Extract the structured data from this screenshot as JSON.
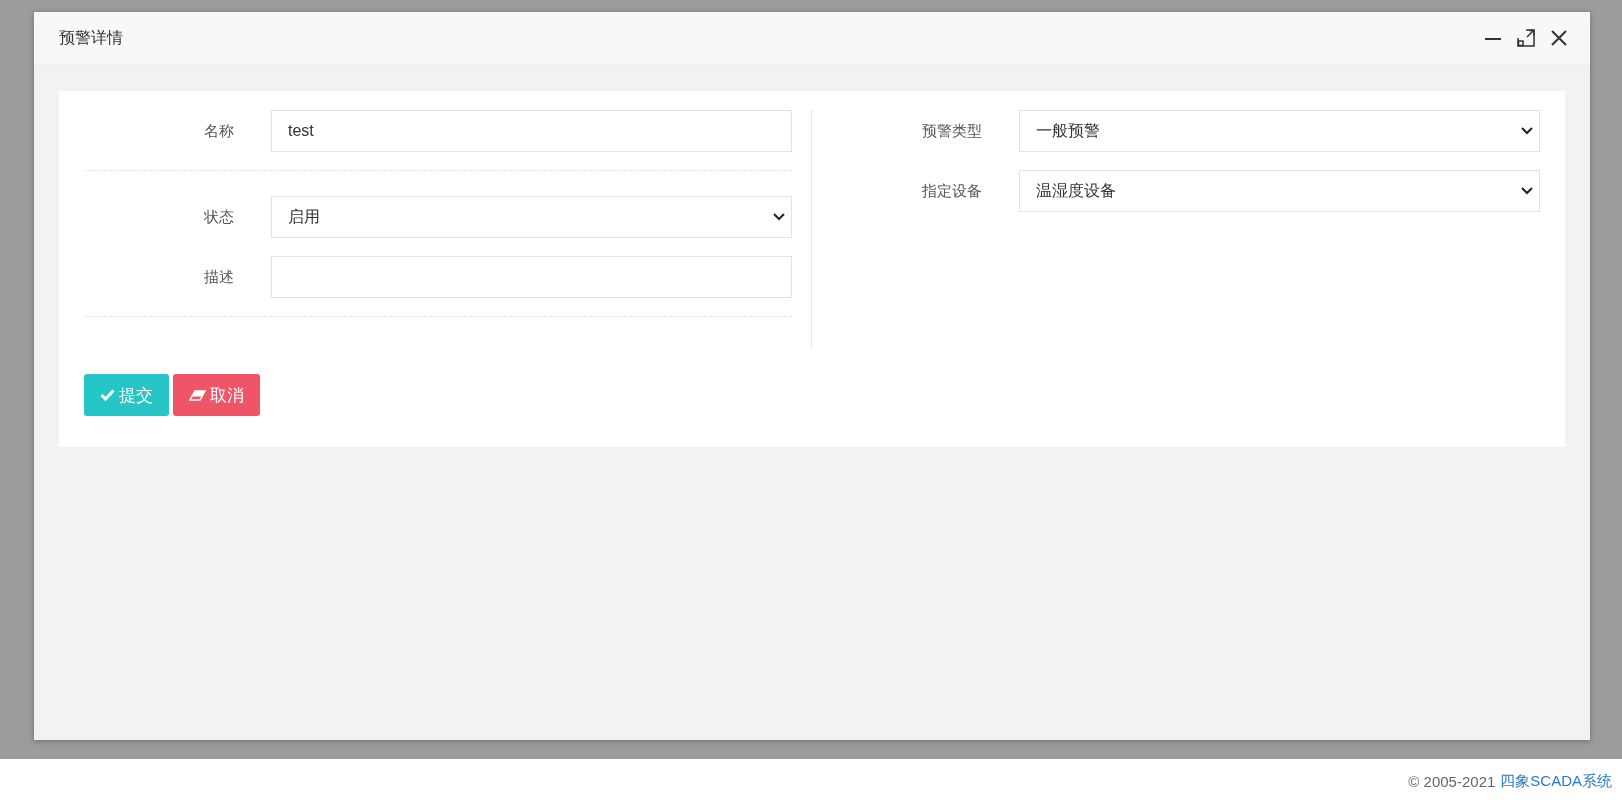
{
  "dialog": {
    "title": "预警详情",
    "controls": [
      {
        "kind": "minimize"
      },
      {
        "kind": "maximize"
      },
      {
        "kind": "close"
      }
    ]
  },
  "form": {
    "left": [
      {
        "label": "名称",
        "kind": "text",
        "value": "test",
        "divider_after": true
      },
      {
        "label": "状态",
        "kind": "select",
        "value": "启用",
        "divider_after": false
      },
      {
        "label": "描述",
        "kind": "text",
        "divider_after": true
      }
    ],
    "right": [
      {
        "label": "预警类型",
        "kind": "select",
        "value": "一般预警",
        "divider_after": false
      },
      {
        "label": "指定设备",
        "kind": "select",
        "value": "温湿度设备",
        "divider_after": false
      }
    ],
    "buttons": [
      {
        "label": "提交",
        "kind": "submit"
      },
      {
        "label": "取消",
        "kind": "cancel"
      }
    ]
  },
  "footer": {
    "copyright": "© 2005-2021",
    "link": "四象SCADA系统"
  }
}
